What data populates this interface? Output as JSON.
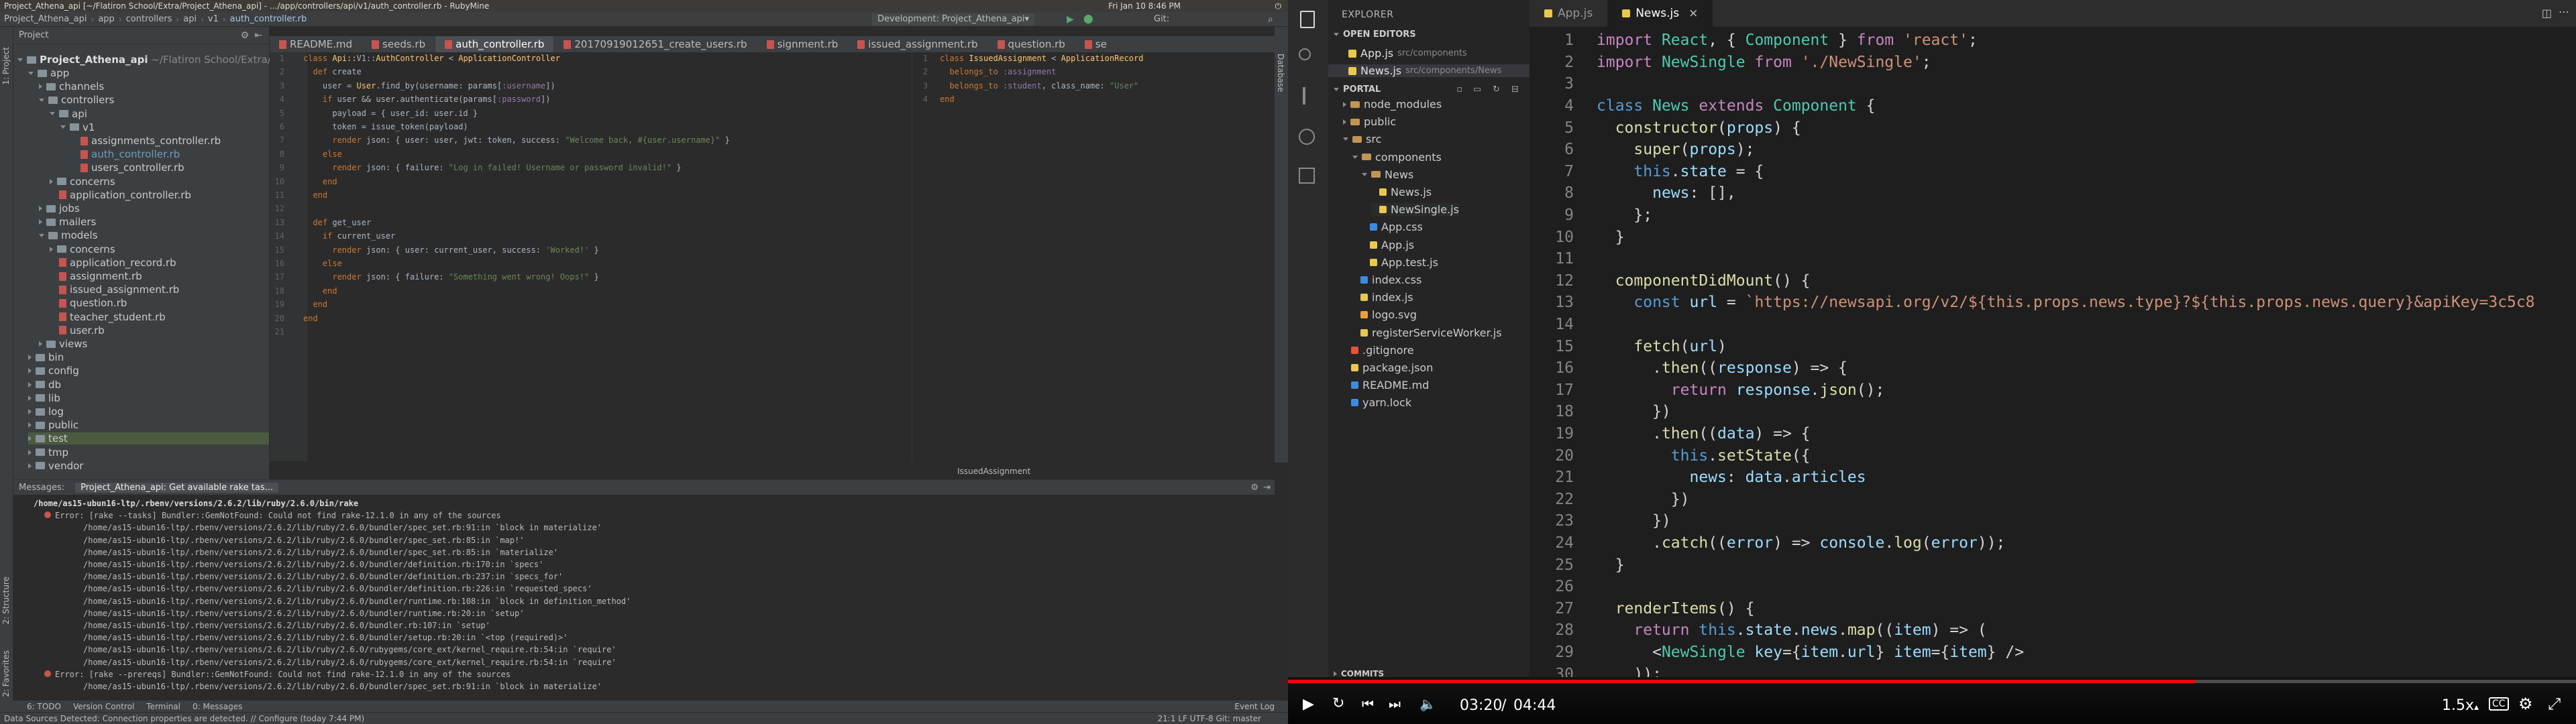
{
  "system_bar": {
    "title": "Project_Athena_api [~/Flatiron School/Extra/Project_Athena_api] - .../app/controllers/api/v1/auth_controller.rb - RubyMine",
    "clock": "Fri Jan 10 8:46 PM"
  },
  "rubymine": {
    "breadcrumbs": [
      "Project_Athena_api",
      "app",
      "controllers",
      "api",
      "v1",
      "auth_controller.rb"
    ],
    "run_config": "Development: Project_Athena_api",
    "git_label": "Git:",
    "project_label": "Project",
    "editor_tabs": [
      "README.md",
      "seeds.rb",
      "auth_controller.rb",
      "20170919012651_create_users.rb",
      "signment.rb",
      "issued_assignment.rb",
      "question.rb",
      "se"
    ],
    "tree_root": "Project_Athena_api",
    "tree_root_path": "~/Flatiron School/Extra/Pr",
    "tree": [
      {
        "label": "app",
        "depth": 1,
        "kind": "folder",
        "open": true
      },
      {
        "label": "channels",
        "depth": 2,
        "kind": "folder",
        "open": false
      },
      {
        "label": "controllers",
        "depth": 2,
        "kind": "folder",
        "open": true
      },
      {
        "label": "api",
        "depth": 3,
        "kind": "folder",
        "open": true
      },
      {
        "label": "v1",
        "depth": 4,
        "kind": "folder",
        "open": true
      },
      {
        "label": "assignments_controller.rb",
        "depth": 5,
        "kind": "rb"
      },
      {
        "label": "auth_controller.rb",
        "depth": 5,
        "kind": "rb",
        "active": true
      },
      {
        "label": "users_controller.rb",
        "depth": 5,
        "kind": "rb"
      },
      {
        "label": "concerns",
        "depth": 3,
        "kind": "folder",
        "open": false
      },
      {
        "label": "application_controller.rb",
        "depth": 3,
        "kind": "rb"
      },
      {
        "label": "jobs",
        "depth": 2,
        "kind": "folder",
        "open": false
      },
      {
        "label": "mailers",
        "depth": 2,
        "kind": "folder",
        "open": false
      },
      {
        "label": "models",
        "depth": 2,
        "kind": "folder",
        "open": true
      },
      {
        "label": "concerns",
        "depth": 3,
        "kind": "folder",
        "open": false
      },
      {
        "label": "application_record.rb",
        "depth": 3,
        "kind": "rb"
      },
      {
        "label": "assignment.rb",
        "depth": 3,
        "kind": "rb"
      },
      {
        "label": "issued_assignment.rb",
        "depth": 3,
        "kind": "rb"
      },
      {
        "label": "question.rb",
        "depth": 3,
        "kind": "rb"
      },
      {
        "label": "teacher_student.rb",
        "depth": 3,
        "kind": "rb"
      },
      {
        "label": "user.rb",
        "depth": 3,
        "kind": "rb"
      },
      {
        "label": "views",
        "depth": 2,
        "kind": "folder",
        "open": false
      },
      {
        "label": "bin",
        "depth": 1,
        "kind": "folder",
        "open": false
      },
      {
        "label": "config",
        "depth": 1,
        "kind": "folder",
        "open": false
      },
      {
        "label": "db",
        "depth": 1,
        "kind": "folder",
        "open": false
      },
      {
        "label": "lib",
        "depth": 1,
        "kind": "folder",
        "open": false
      },
      {
        "label": "log",
        "depth": 1,
        "kind": "folder",
        "open": false
      },
      {
        "label": "public",
        "depth": 1,
        "kind": "folder",
        "open": false
      },
      {
        "label": "test",
        "depth": 1,
        "kind": "folder",
        "open": false,
        "highlight": true
      },
      {
        "label": "tmp",
        "depth": 1,
        "kind": "folder",
        "open": false
      },
      {
        "label": "vendor",
        "depth": 1,
        "kind": "folder",
        "open": false
      }
    ],
    "code_lines": [
      "class Api::V1::AuthController < ApplicationController",
      "  def create",
      "    user = User.find_by(username: params[:username])",
      "    if user && user.authenticate(params[:password])",
      "      payload = { user_id: user.id }",
      "      token = issue_token(payload)",
      "      render json: { user: user, jwt: token, success: \"Welcome back, #{user.username}\" }",
      "    else",
      "      render json: { failure: \"Log in failed! Username or password invalid!\" }",
      "    end",
      "  end",
      "",
      "  def get_user",
      "    if current_user",
      "      render json: { user: current_user, success: 'Worked!' }",
      "    else",
      "      render json: { failure: \"Something went wrong! Oops!\" }",
      "    end",
      "  end",
      "end",
      ""
    ],
    "split_lines": [
      "class IssuedAssignment < ApplicationRecord",
      "  belongs_to :assignment",
      "  belongs_to :student, class_name: \"User\"",
      "end"
    ],
    "split_footer": "IssuedAssignment",
    "messages_label": "Messages:",
    "messages_tab": "Project_Athena_api: Get available rake tas...",
    "messages": [
      "/home/as15-ubun16-ltp/.rbenv/versions/2.6.2/lib/ruby/2.6.0/bin/rake",
      "Error: [rake --tasks] Bundler::GemNotFound: Could not find rake-12.1.0 in any of the sources",
      "/home/as15-ubun16-ltp/.rbenv/versions/2.6.2/lib/ruby/2.6.0/bundler/spec_set.rb:91:in `block in materialize'",
      "/home/as15-ubun16-ltp/.rbenv/versions/2.6.2/lib/ruby/2.6.0/bundler/spec_set.rb:85:in `map!'",
      "/home/as15-ubun16-ltp/.rbenv/versions/2.6.2/lib/ruby/2.6.0/bundler/spec_set.rb:85:in `materialize'",
      "/home/as15-ubun16-ltp/.rbenv/versions/2.6.2/lib/ruby/2.6.0/bundler/definition.rb:170:in `specs'",
      "/home/as15-ubun16-ltp/.rbenv/versions/2.6.2/lib/ruby/2.6.0/bundler/definition.rb:237:in `specs_for'",
      "/home/as15-ubun16-ltp/.rbenv/versions/2.6.2/lib/ruby/2.6.0/bundler/definition.rb:226:in `requested_specs'",
      "/home/as15-ubun16-ltp/.rbenv/versions/2.6.2/lib/ruby/2.6.0/bundler/runtime.rb:108:in `block in definition_method'",
      "/home/as15-ubun16-ltp/.rbenv/versions/2.6.2/lib/ruby/2.6.0/bundler/runtime.rb:20:in `setup'",
      "/home/as15-ubun16-ltp/.rbenv/versions/2.6.2/lib/ruby/2.6.0/bundler.rb:107:in `setup'",
      "/home/as15-ubun16-ltp/.rbenv/versions/2.6.2/lib/ruby/2.6.0/bundler/setup.rb:20:in `<top (required)>'",
      "/home/as15-ubun16-ltp/.rbenv/versions/2.6.2/lib/ruby/2.6.0/rubygems/core_ext/kernel_require.rb:54:in `require'",
      "/home/as15-ubun16-ltp/.rbenv/versions/2.6.2/lib/ruby/2.6.0/rubygems/core_ext/kernel_require.rb:54:in `require'",
      "Error: [rake --prereqs] Bundler::GemNotFound: Could not find rake-12.1.0 in any of the sources",
      "/home/as15-ubun16-ltp/.rbenv/versions/2.6.2/lib/ruby/2.6.0/bundler/spec_set.rb:91:in `block in materialize'"
    ],
    "bottom_tabs": [
      "6: TODO",
      "Version Control",
      "Terminal",
      "0: Messages"
    ],
    "event_log": "Event Log",
    "status_left": "Data Sources Detected: Connection properties are detected. // Configure (today 7:44 PM)",
    "status_right": "21:1  LF  UTF-8  Git: master",
    "side_tabs": [
      "1: Project",
      "2: Structure",
      "2: Favorites"
    ],
    "right_side_tab": "Database"
  },
  "vscode": {
    "tabs": [
      {
        "label": "App.js",
        "active": false
      },
      {
        "label": "News.js",
        "active": true
      }
    ],
    "explorer_title": "EXPLORER",
    "open_editors_title": "OPEN EDITORS",
    "open_editors": [
      {
        "name": "App.js",
        "path": "src/components"
      },
      {
        "name": "News.js",
        "path": "src/components/News"
      }
    ],
    "portal_title": "PORTAL",
    "tree": [
      {
        "label": "node_modules",
        "depth": 1,
        "kind": "folder"
      },
      {
        "label": "public",
        "depth": 1,
        "kind": "folder"
      },
      {
        "label": "src",
        "depth": 1,
        "kind": "folder",
        "open": true
      },
      {
        "label": "components",
        "depth": 2,
        "kind": "folder",
        "open": true
      },
      {
        "label": "News",
        "depth": 3,
        "kind": "folder",
        "open": true
      },
      {
        "label": "News.js",
        "depth": 4,
        "kind": "js"
      },
      {
        "label": "NewSingle.js",
        "depth": 4,
        "kind": "js",
        "hover": true
      },
      {
        "label": "App.css",
        "depth": 3,
        "kind": "css"
      },
      {
        "label": "App.js",
        "depth": 3,
        "kind": "js"
      },
      {
        "label": "App.test.js",
        "depth": 3,
        "kind": "js"
      },
      {
        "label": "index.css",
        "depth": 2,
        "kind": "css"
      },
      {
        "label": "index.js",
        "depth": 2,
        "kind": "js"
      },
      {
        "label": "logo.svg",
        "depth": 2,
        "kind": "svg"
      },
      {
        "label": "registerServiceWorker.js",
        "depth": 2,
        "kind": "js"
      },
      {
        "label": ".gitignore",
        "depth": 1,
        "kind": "git"
      },
      {
        "label": "package.json",
        "depth": 1,
        "kind": "json"
      },
      {
        "label": "README.md",
        "depth": 1,
        "kind": "md"
      },
      {
        "label": "yarn.lock",
        "depth": 1,
        "kind": "lock"
      }
    ],
    "commits_title": "COMMITS",
    "code": [
      "import React, { Component } from 'react';",
      "import NewSingle from './NewSingle';",
      "",
      "class News extends Component {",
      "  constructor(props) {",
      "    super(props);",
      "    this.state = {",
      "      news: [],",
      "    };",
      "  }",
      "",
      "  componentDidMount() {",
      "    const url = `https://newsapi.org/v2/${this.props.news.type}?${this.props.news.query}&apiKey=3c5c8",
      "",
      "    fetch(url)",
      "      .then((response) => {",
      "        return response.json();",
      "      })",
      "      .then((data) => {",
      "        this.setState({",
      "          news: data.articles",
      "        })",
      "      })",
      "      .catch((error) => console.log(error));",
      "  }",
      "",
      "  renderItems() {",
      "    return this.state.news.map((item) => (",
      "      <NewSingle key={item.url} item={item} />",
      "    ));"
    ]
  },
  "player": {
    "time_current": "03:20",
    "time_total": "04:44",
    "speed": "1.5x",
    "progress": 0.704,
    "accent": "#ff0000"
  }
}
